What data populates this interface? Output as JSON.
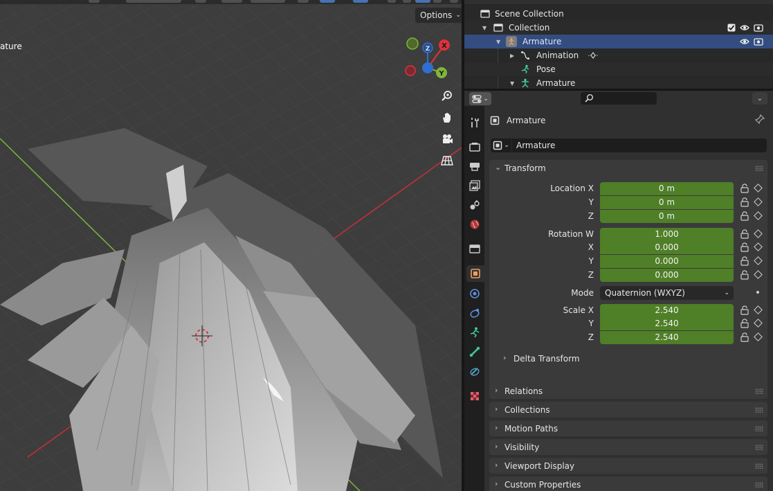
{
  "viewport": {
    "options_label": "Options",
    "overlay_label": "ature",
    "gizmo": {
      "x": "X",
      "y": "Y",
      "z": "Z"
    },
    "colors": {
      "x_axis": "#e0323a",
      "y_axis": "#7fb63b",
      "z_axis": "#2f6fd1",
      "grid": "#474747",
      "background": "#3d3d3d"
    }
  },
  "outliner": {
    "rows": [
      {
        "label": "Scene Collection",
        "icon": "scene-collection-icon"
      },
      {
        "label": "Collection",
        "icon": "collection-icon"
      },
      {
        "label": "Armature",
        "icon": "armature-object-icon",
        "selected": true
      },
      {
        "label": "Animation",
        "icon": "animation-icon"
      },
      {
        "label": "Pose",
        "icon": "pose-icon"
      },
      {
        "label": "Armature",
        "icon": "armature-data-icon"
      }
    ]
  },
  "properties": {
    "object_name": "Armature",
    "data_name": "Armature",
    "transform": {
      "title": "Transform",
      "location": {
        "label": "Location X",
        "y_label": "Y",
        "z_label": "Z",
        "x": "0 m",
        "y": "0 m",
        "z": "0 m"
      },
      "rotation": {
        "label": "Rotation W",
        "x_label": "X",
        "y_label": "Y",
        "z_label": "Z",
        "w": "1.000",
        "x": "0.000",
        "y": "0.000",
        "z": "0.000"
      },
      "mode": {
        "label": "Mode",
        "value": "Quaternion (WXYZ)"
      },
      "scale": {
        "label": "Scale X",
        "y_label": "Y",
        "z_label": "Z",
        "x": "2.540",
        "y": "2.540",
        "z": "2.540"
      },
      "delta": "Delta Transform"
    },
    "panels": [
      "Relations",
      "Collections",
      "Motion Paths",
      "Visibility",
      "Viewport Display",
      "Custom Properties"
    ],
    "accent_field_color": "#4f7f27",
    "selection_color": "#334d80"
  }
}
